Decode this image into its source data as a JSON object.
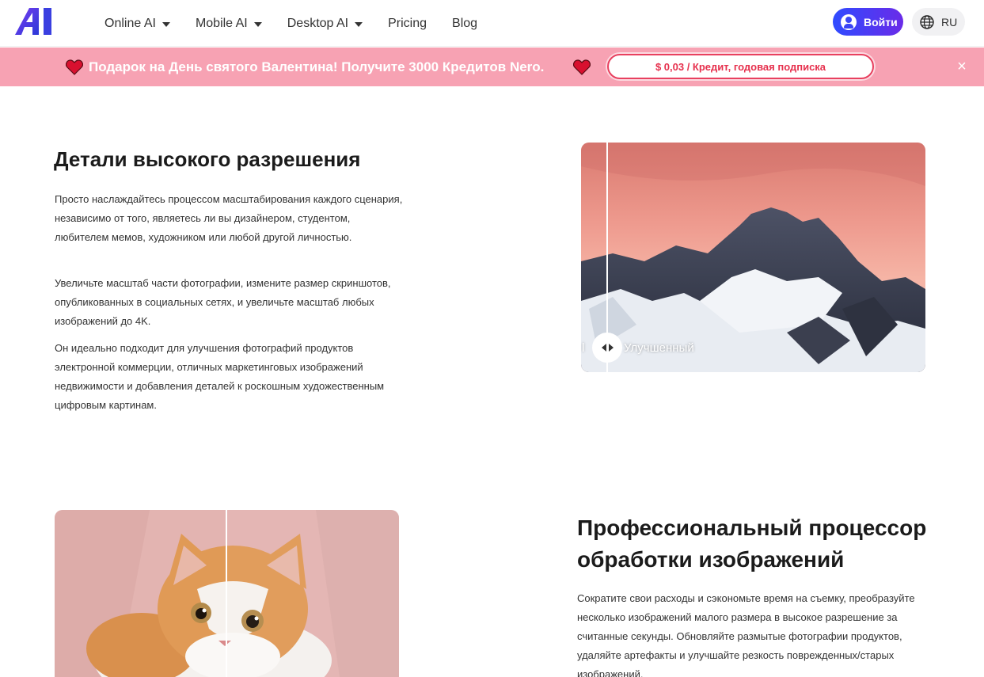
{
  "header": {
    "logo_text": "AI",
    "nav": [
      {
        "label": "Online AI",
        "dropdown": true
      },
      {
        "label": "Mobile AI",
        "dropdown": true
      },
      {
        "label": "Desktop AI",
        "dropdown": true
      },
      {
        "label": "Pricing",
        "dropdown": false
      },
      {
        "label": "Blog",
        "dropdown": false
      }
    ],
    "login_label": "Войти",
    "lang_label": "RU"
  },
  "promo": {
    "text": "Подарок на День святого Валентина! Получите 3000 Кредитов Nero.",
    "button_label": "$ 0,03 / Кредит, годовая подписка",
    "close_glyph": "×"
  },
  "section1": {
    "title": "Детали высокого разрешения",
    "paragraphs": [
      "Просто наслаждайтесь процессом масштабирования каждого сценария, независимо от того, являетесь ли вы дизайнером, студентом, любителем мемов, художником или любой другой личностью.",
      "Увеличьте масштаб части фотографии, измените размер скриншотов, опубликованных в социальных сетях, и увеличьте масштаб любых изображений до 4K.",
      "Он идеально подходит для улучшения фотографий продуктов электронной коммерции, отличных маркетинговых изображений недвижимости и добавления деталей к роскошным художественным цифровым картинам."
    ],
    "compare_left_label": "l",
    "compare_right_label": "Улучшенный"
  },
  "section2": {
    "title": "Профессиональный процессор обработки изображений",
    "paragraph": "Сократите свои расходы и сэкономьте время на съемку, преобразуйте несколько изображений малого размера в высокое разрешение за считанные секунды. Обновляйте размытые фотографии продуктов, удаляйте артефакты и улучшайте резкость поврежденных/старых изображений."
  },
  "colors": {
    "accent_gradient_start": "#2f4bff",
    "accent_gradient_end": "#6a2be8",
    "promo_bg": "#f7a2b3",
    "promo_button_text": "#e6304d"
  }
}
